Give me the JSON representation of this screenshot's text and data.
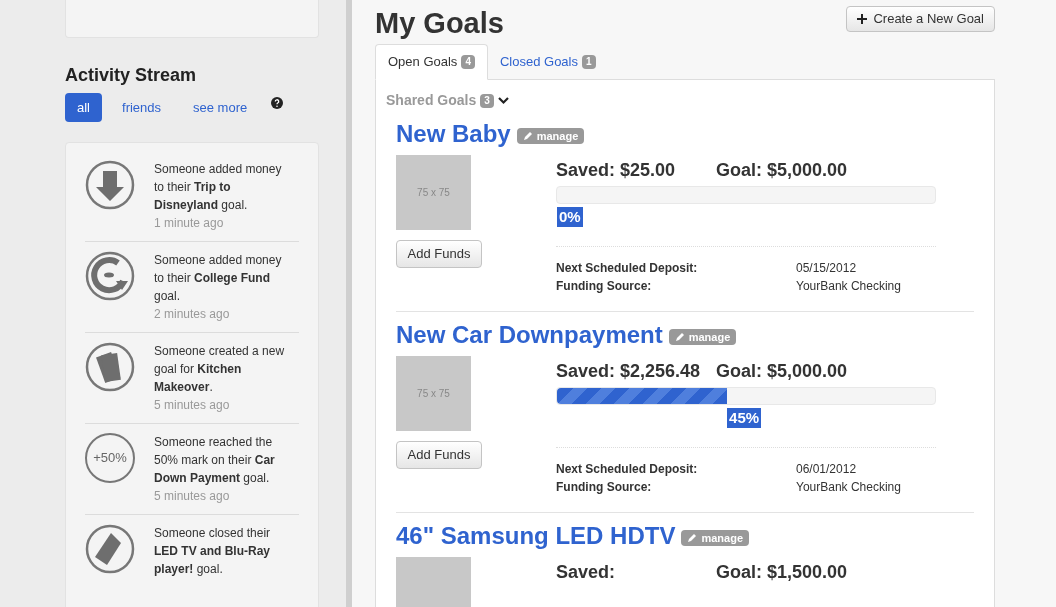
{
  "activity": {
    "title": "Activity Stream",
    "filters": [
      {
        "label": "all",
        "selected": true
      },
      {
        "label": "friends",
        "selected": false
      },
      {
        "label": "see more",
        "selected": false
      }
    ],
    "items": [
      {
        "kind": "deposit",
        "text": "Someone added money to their **Trip to Disneyland** goal.",
        "time": "1 minute ago"
      },
      {
        "kind": "recurring",
        "text": "Someone added money to their **College Fund** goal.",
        "time": "2 minutes ago"
      },
      {
        "kind": "cash",
        "text": "Someone created a new goal for **Kitchen Makeover**.",
        "time": "5 minutes ago"
      },
      {
        "kind": "badge",
        "badge": "+50%",
        "text": "Someone reached the 50% mark on their **Car Down Payment** goal.",
        "time": "5 minutes ago"
      },
      {
        "kind": "tag",
        "text": "Someone closed their **LED TV and Blu-Ray player!** goal."
      }
    ]
  },
  "page": {
    "title": "My Goals",
    "create_button": "Create a New Goal"
  },
  "tabs": [
    {
      "label": "Open Goals",
      "count": "4",
      "selected": true
    },
    {
      "label": "Closed Goals",
      "count": "1",
      "selected": false
    }
  ],
  "shared": {
    "label": "Shared Goals",
    "count": "3"
  },
  "goals": [
    {
      "title": "New Baby",
      "manage": "manage",
      "image": "75 x 75",
      "saved": "Saved:",
      "saved_amount": "$25.00",
      "goal": "Goal: $5,000.00",
      "level": 0,
      "percent": "0%",
      "add_funds": "Add Funds",
      "details": [
        {
          "label": "Next Scheduled Deposit:",
          "value": "05/15/2012"
        },
        {
          "label": "Funding Source:",
          "value": "YourBank Checking"
        }
      ]
    },
    {
      "title": "New Car Downpayment",
      "manage": "manage",
      "image": "75 x 75",
      "saved": "Saved:",
      "saved_amount": "$2,256.48",
      "goal": "Goal: $5,000.00",
      "level": 0.45,
      "percent": "45%",
      "add_funds": "Add Funds",
      "details": [
        {
          "label": "Next Scheduled Deposit:",
          "value": "06/01/2012"
        },
        {
          "label": "Funding Source:",
          "value": "YourBank Checking"
        }
      ]
    },
    {
      "title": "46\" Samsung LED HDTV",
      "manage": "manage",
      "saved": "Saved:",
      "goal": "Goal: $1,500.00"
    }
  ]
}
